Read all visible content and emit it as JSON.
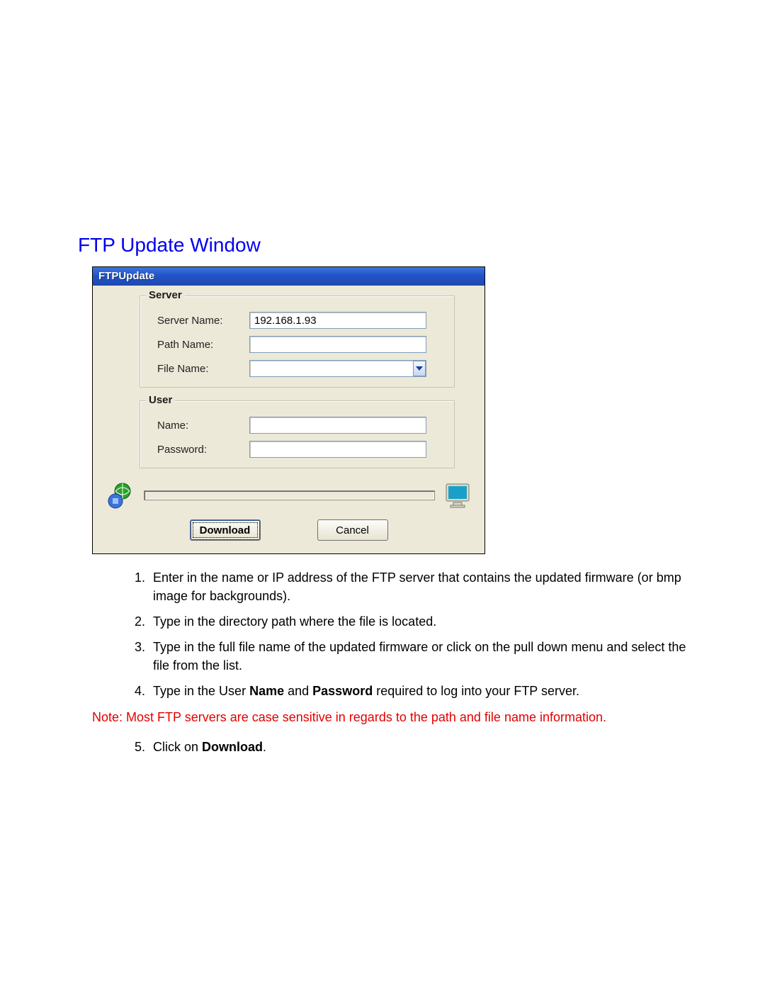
{
  "section_title": "FTP Update Window",
  "dialog": {
    "title": "FTPUpdate",
    "groups": {
      "server": {
        "legend": "Server",
        "fields": {
          "server_name": {
            "label": "Server Name:",
            "value": "192.168.1.93"
          },
          "path_name": {
            "label": "Path Name:",
            "value": ""
          },
          "file_name": {
            "label": "File Name:",
            "value": ""
          }
        }
      },
      "user": {
        "legend": "User",
        "fields": {
          "name": {
            "label": "Name:",
            "value": ""
          },
          "password": {
            "label": "Password:",
            "value": ""
          }
        }
      }
    },
    "buttons": {
      "download": "Download",
      "cancel": "Cancel"
    },
    "progress_percent": 0
  },
  "instructions": {
    "item1": "Enter in the name or IP address of the FTP server that contains the updated firmware (or bmp image for backgrounds).",
    "item2": "Type in the directory path where the file is located.",
    "item3": "Type in the full file name of the updated firmware or click on the pull down menu and select the file from the list.",
    "item4_pre": "Type in the User ",
    "item4_bold1": "Name",
    "item4_mid": " and ",
    "item4_bold2": "Password",
    "item4_post": " required to log into your FTP server.",
    "item5_pre": "Click on ",
    "item5_bold": "Download",
    "item5_post": "."
  },
  "note_text": "Note:  Most FTP servers are case sensitive in regards to the path and file name information."
}
